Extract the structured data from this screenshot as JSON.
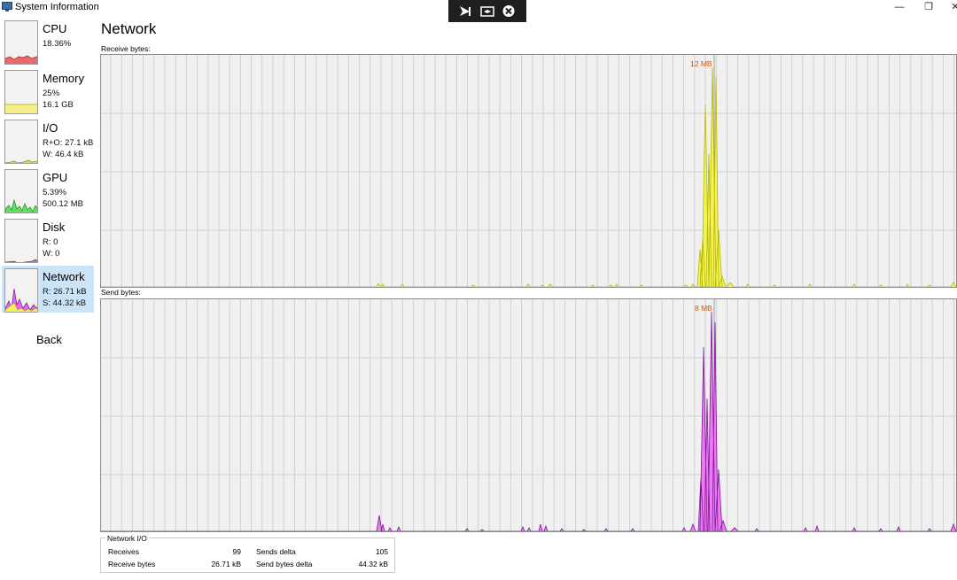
{
  "window": {
    "title": "System Information",
    "minimize_glyph": "—",
    "restore_glyph": "❐",
    "close_glyph": "✕"
  },
  "overlay": {
    "buttons": [
      "pointer-icon",
      "resize-icon",
      "close-circle-icon"
    ]
  },
  "sidebar": {
    "items": [
      {
        "name": "CPU",
        "lines": [
          "18.36%"
        ],
        "color": "#e85b5b"
      },
      {
        "name": "Memory",
        "lines": [
          "25%",
          "16.1 GB"
        ],
        "color": "#f5f08a"
      },
      {
        "name": "I/O",
        "lines": [
          "R+O: 27.1 kB",
          "W: 46.4 kB"
        ],
        "color": "#c8c82a"
      },
      {
        "name": "GPU",
        "lines": [
          "5.39%",
          "500.12 MB"
        ],
        "color": "#3ad13a"
      },
      {
        "name": "Disk",
        "lines": [
          "R: 0",
          "W: 0"
        ],
        "color": "#7a3aa0"
      },
      {
        "name": "Network",
        "lines": [
          "R: 26.71 kB",
          "S: 44.32 kB"
        ],
        "color": "#c040c0"
      }
    ],
    "back_label": "Back"
  },
  "main": {
    "title": "Network",
    "receive": {
      "label": "Receive bytes:",
      "peak": "12 MB",
      "fill": "#f2f25a",
      "stroke": "#b8b800"
    },
    "send": {
      "label": "Send bytes:",
      "peak": "8 MB",
      "fill": "#ee7aee",
      "stroke": "#7a1a9a"
    }
  },
  "network_io": {
    "legend": "Network I/O",
    "receives_label": "Receives",
    "receives_value": "99",
    "receive_bytes_label": "Receive bytes",
    "receive_bytes_value": "26.71 kB",
    "sends_delta_label": "Sends delta",
    "sends_delta_value": "105",
    "send_bytes_delta_label": "Send bytes delta",
    "send_bytes_delta_value": "44.32 kB"
  }
}
